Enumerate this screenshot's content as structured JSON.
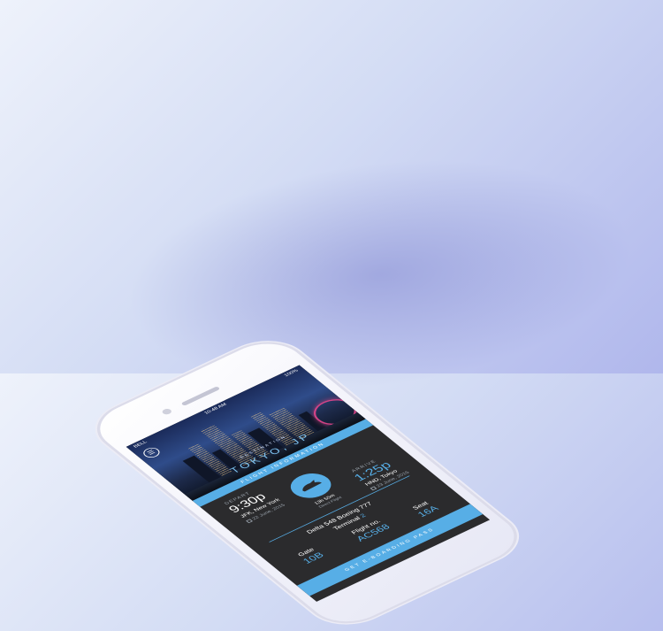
{
  "status_bar": {
    "carrier": "BELL",
    "time": "10:48 AM",
    "battery": "100%"
  },
  "icons": {
    "menu": "list-icon",
    "plane": "airplane-icon",
    "calendar": "calendar-icon",
    "wifi": "wifi-icon",
    "bluetooth": "bluetooth-icon"
  },
  "destination": {
    "label": "DESTINATION",
    "city": "TOKYO, JP"
  },
  "flight_info_label": "FLIGHT INFORMATION",
  "depart": {
    "label": "DEPART",
    "time": "9:30p",
    "place": "JFK, New York",
    "date": "22 June, 2015"
  },
  "arrive": {
    "label": "ARRIVE",
    "time": "1:25p",
    "place": "HND, Tokyo",
    "date": "23 June, 2015"
  },
  "duration": {
    "value": "13h 55m",
    "note": "Direct Flight"
  },
  "aircraft": "Delta 548 Boeing 777",
  "terminal": {
    "label": "Terminal",
    "value": "2"
  },
  "gate": {
    "label": "Gate",
    "value": "10B"
  },
  "flight_no": {
    "label": "Flight no.",
    "value": "AC568"
  },
  "seat": {
    "label": "Seat",
    "value": "16A"
  },
  "boarding_button": "GET E-BOARDING PASS",
  "colors": {
    "accent": "#57aee6",
    "screen_bg": "#2b2b2d"
  }
}
